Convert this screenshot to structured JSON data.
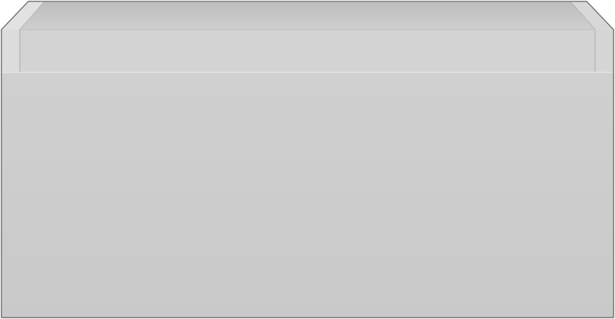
{
  "image": {
    "subject": "drawer-unit",
    "colors": {
      "background": "#ffffff",
      "outline": "#6f6f6f",
      "top_rim": "#d6d6d6",
      "inner_back_wall": "#cacaca",
      "inner_shadow": "#b9b9b9",
      "rear_lip": "#d2d2d2",
      "front_panel": "#cdcdcd",
      "side_post": "#d9d9d9",
      "highlight": "#e3e3e3",
      "seam_line": "#a8a8a8"
    }
  }
}
